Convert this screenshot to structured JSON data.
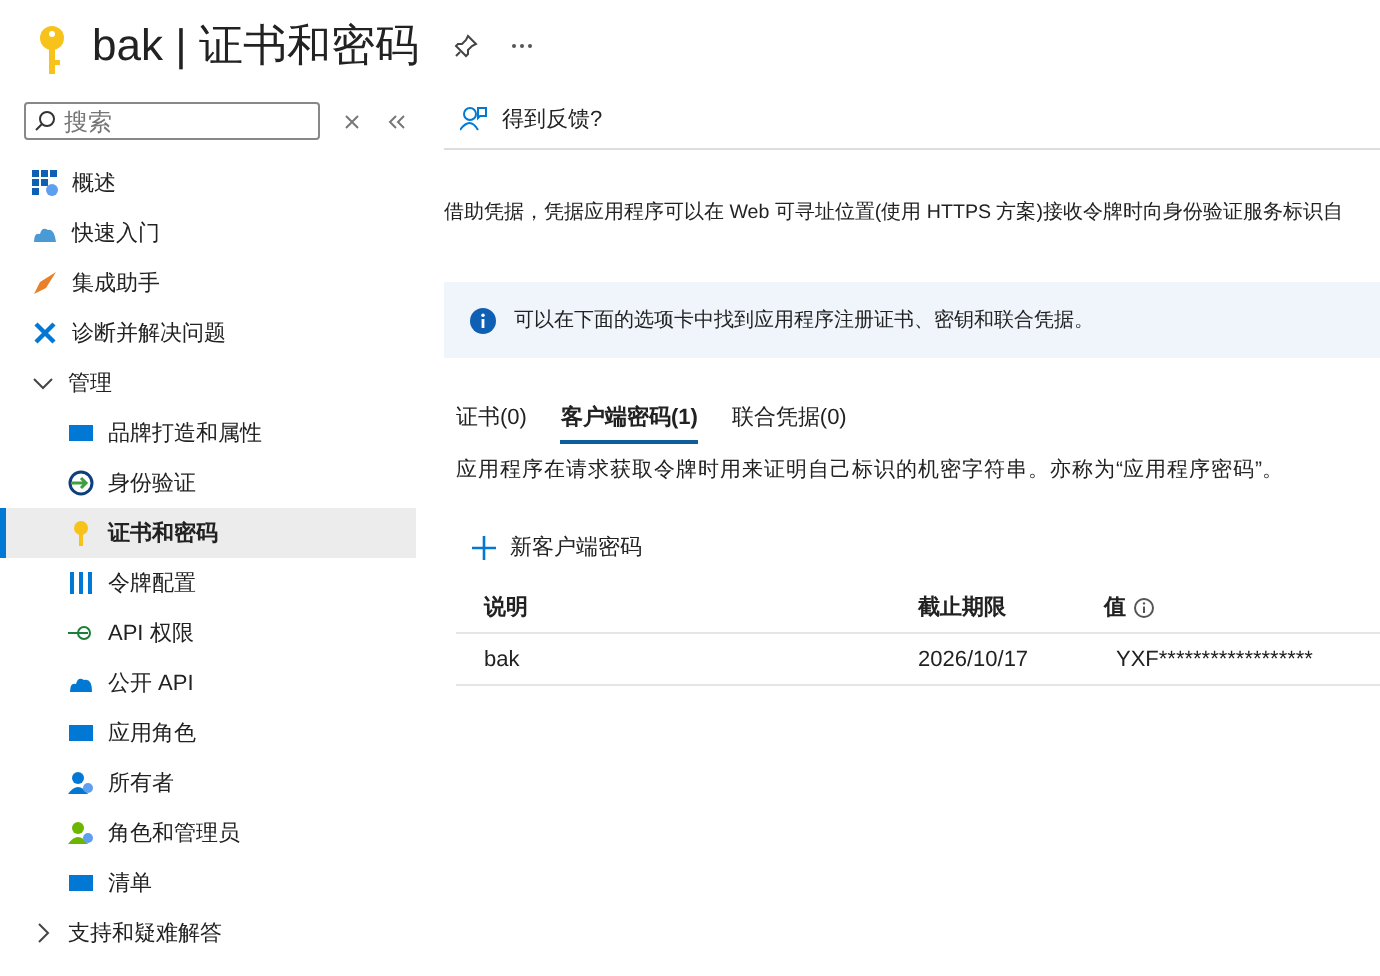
{
  "header": {
    "title": "bak | 证书和密码"
  },
  "sidebar": {
    "search": {
      "placeholder": "搜索"
    },
    "items": [
      {
        "kind": "link",
        "label": "概述",
        "selected": false
      },
      {
        "kind": "link",
        "label": "快速入门",
        "selected": false
      },
      {
        "kind": "link",
        "label": "集成助手",
        "selected": false
      },
      {
        "kind": "link",
        "label": "诊断并解决问题",
        "selected": false
      },
      {
        "kind": "group",
        "label": "管理",
        "expanded": true,
        "children": [
          {
            "label": "品牌打造和属性",
            "selected": false
          },
          {
            "label": "身份验证",
            "selected": false
          },
          {
            "label": "证书和密码",
            "selected": true
          },
          {
            "label": "令牌配置",
            "selected": false
          },
          {
            "label": "API 权限",
            "selected": false
          },
          {
            "label": "公开 API",
            "selected": false
          },
          {
            "label": "应用角色",
            "selected": false
          },
          {
            "label": "所有者",
            "selected": false
          },
          {
            "label": "角色和管理员",
            "selected": false
          },
          {
            "label": "清单",
            "selected": false
          }
        ]
      },
      {
        "kind": "group",
        "label": "支持和疑难解答",
        "expanded": false
      }
    ]
  },
  "toolbar": {
    "feedback": "得到反馈?"
  },
  "description": "借助凭据，凭据应用程序可以在 Web 可寻址位置(使用 HTTPS 方案)接收令牌时向身份验证服务标识自",
  "info_banner": "可以在下面的选项卡中找到应用程序注册证书、密钥和联合凭据。",
  "tabs": [
    {
      "label": "证书(0)",
      "selected": false
    },
    {
      "label": "客户端密码(1)",
      "selected": true
    },
    {
      "label": "联合凭据(0)",
      "selected": false
    }
  ],
  "tab_description": "应用程序在请求获取令牌时用来证明自己标识的机密字符串。亦称为“应用程序密码”。",
  "new_button": "新客户端密码",
  "table": {
    "columns": [
      "说明",
      "截止期限",
      "值"
    ],
    "rows": [
      [
        "bak",
        "2026/10/17",
        "YXF******************"
      ]
    ]
  }
}
